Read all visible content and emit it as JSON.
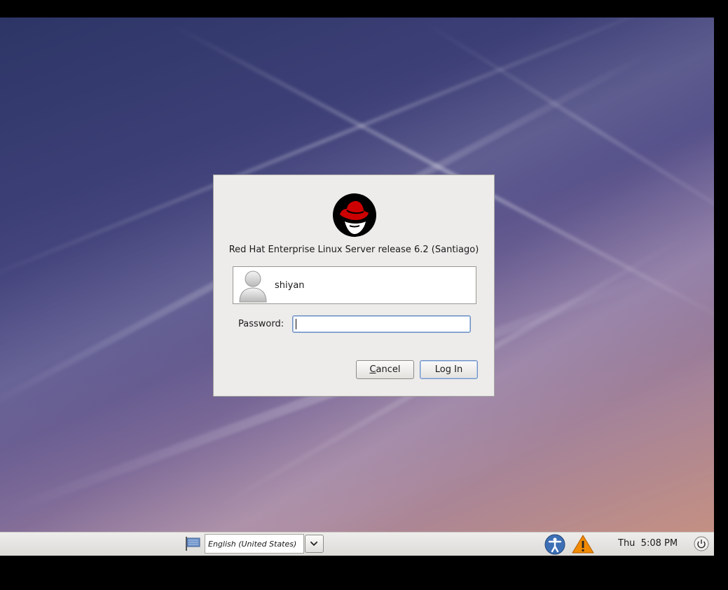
{
  "dialog": {
    "release_text": "Red Hat Enterprise Linux Server release 6.2 (Santiago)",
    "user_name": "shiyan",
    "password_label": "Password:",
    "password_value": "",
    "cancel_label": "Cancel",
    "login_label": "Log In"
  },
  "panel": {
    "language": "English (United States)",
    "clock": "Thu  5:08 PM"
  },
  "colors": {
    "redhat_red": "#cc0000",
    "dialog_bg": "#edeceb",
    "warning_orange": "#f08a00",
    "accessibility_blue": "#3d6fb5"
  },
  "icons": [
    "redhat-logo",
    "user-avatar-icon",
    "language-flag-icon",
    "chevron-down-icon",
    "accessibility-icon",
    "warning-icon",
    "power-icon"
  ]
}
